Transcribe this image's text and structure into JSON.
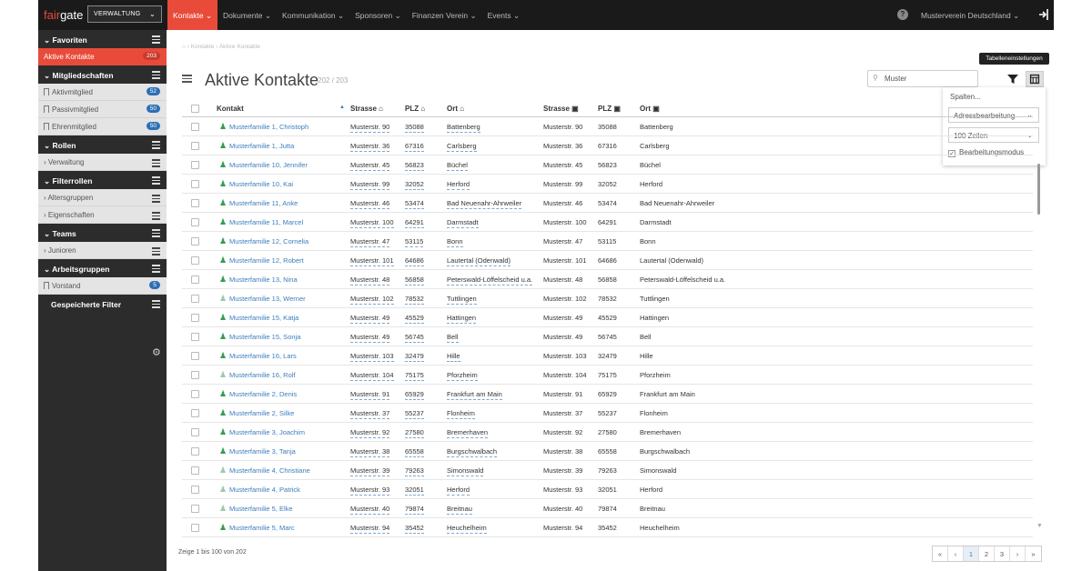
{
  "app": {
    "logo_part1": "fair",
    "logo_part2": "gate",
    "selector": "VERWALTUNG",
    "org_name": "Musterverein Deutschland"
  },
  "nav": [
    "Kontakte",
    "Dokumente",
    "Kommunikation",
    "Sponsoren",
    "Finanzen Verein",
    "Events"
  ],
  "sidebar": {
    "favoriten": {
      "title": "Favoriten",
      "items": [
        {
          "label": "Aktive Kontakte",
          "count": "203"
        }
      ]
    },
    "mitglied": {
      "title": "Mitgliedschaften",
      "items": [
        {
          "label": "Aktivmitglied",
          "count": "52"
        },
        {
          "label": "Passivmitglied",
          "count": "50"
        },
        {
          "label": "Ehrenmitglied",
          "count": "50"
        }
      ]
    },
    "rollen": {
      "title": "Rollen",
      "items": [
        {
          "label": "Verwaltung"
        }
      ]
    },
    "filter": {
      "title": "Filterrollen",
      "items": [
        {
          "label": "Altersgruppen"
        },
        {
          "label": "Eigenschaften"
        }
      ]
    },
    "teams": {
      "title": "Teams",
      "items": [
        {
          "label": "Junioren"
        }
      ]
    },
    "arbeit": {
      "title": "Arbeitsgruppen",
      "items": [
        {
          "label": "Vorstand",
          "count": "5"
        }
      ]
    },
    "saved": {
      "title": "Gespeicherte Filter"
    }
  },
  "breadcrumb": {
    "a": "Kontakte",
    "b": "Aktive Kontakte"
  },
  "page": {
    "title": "Aktive Kontakte",
    "count": "202 / 203"
  },
  "search": {
    "value": "Muster"
  },
  "tooltip": "Tabelleneinstellungen",
  "popup": {
    "label": "Spalten...",
    "select1": "Adressbearbeitung",
    "select2": "100 Zeilen",
    "checkbox": "Bearbeitungsmodus"
  },
  "columns": [
    "Kontakt",
    "Strasse",
    "PLZ",
    "Ort",
    "Strasse",
    "PLZ",
    "Ort"
  ],
  "rows": [
    [
      "Musterfamilie 1, Christoph",
      "Musterstr. 90",
      "35088",
      "Battenberg",
      "Musterstr. 90",
      "35088",
      "Battenberg"
    ],
    [
      "Musterfamilie 1, Jutta",
      "Musterstr. 36",
      "67316",
      "Carlsberg",
      "Musterstr. 36",
      "67316",
      "Carlsberg"
    ],
    [
      "Musterfamilie 10, Jennifer",
      "Musterstr. 45",
      "56823",
      "Büchel",
      "Musterstr. 45",
      "56823",
      "Büchel"
    ],
    [
      "Musterfamilie 10, Kai",
      "Musterstr. 99",
      "32052",
      "Herford",
      "Musterstr. 99",
      "32052",
      "Herford"
    ],
    [
      "Musterfamilie 11, Anke",
      "Musterstr. 46",
      "53474",
      "Bad Neuenahr-Ahrweiler",
      "Musterstr. 46",
      "53474",
      "Bad Neuenahr-Ahrweiler"
    ],
    [
      "Musterfamilie 11, Marcel",
      "Musterstr. 100",
      "64291",
      "Darmstadt",
      "Musterstr. 100",
      "64291",
      "Darmstadt"
    ],
    [
      "Musterfamilie 12, Cornelia",
      "Musterstr. 47",
      "53115",
      "Bonn",
      "Musterstr. 47",
      "53115",
      "Bonn"
    ],
    [
      "Musterfamilie 12, Robert",
      "Musterstr. 101",
      "64686",
      "Lautertal (Odenwald)",
      "Musterstr. 101",
      "64686",
      "Lautertal (Odenwald)"
    ],
    [
      "Musterfamilie 13, Nina",
      "Musterstr. 48",
      "56858",
      "Peterswald-Löffelscheid u.a.",
      "Musterstr. 48",
      "56858",
      "Peterswald-Löffelscheid u.a."
    ],
    [
      "Musterfamilie 13, Werner",
      "Musterstr. 102",
      "78532",
      "Tuttlingen",
      "Musterstr. 102",
      "78532",
      "Tuttlingen"
    ],
    [
      "Musterfamilie 15, Katja",
      "Musterstr. 49",
      "45529",
      "Hattingen",
      "Musterstr. 49",
      "45529",
      "Hattingen"
    ],
    [
      "Musterfamilie 15, Sonja",
      "Musterstr. 49",
      "56745",
      "Bell",
      "Musterstr. 49",
      "56745",
      "Bell"
    ],
    [
      "Musterfamilie 16, Lars",
      "Musterstr. 103",
      "32479",
      "Hille",
      "Musterstr. 103",
      "32479",
      "Hille"
    ],
    [
      "Musterfamilie 16, Rolf",
      "Musterstr. 104",
      "75175",
      "Pforzheim",
      "Musterstr. 104",
      "75175",
      "Pforzheim"
    ],
    [
      "Musterfamilie 2, Denis",
      "Musterstr. 91",
      "65929",
      "Frankfurt am Main",
      "Musterstr. 91",
      "65929",
      "Frankfurt am Main"
    ],
    [
      "Musterfamilie 2, Silke",
      "Musterstr. 37",
      "55237",
      "Flonheim",
      "Musterstr. 37",
      "55237",
      "Flonheim"
    ],
    [
      "Musterfamilie 3, Joachim",
      "Musterstr. 92",
      "27580",
      "Bremerhaven",
      "Musterstr. 92",
      "27580",
      "Bremerhaven"
    ],
    [
      "Musterfamilie 3, Tanja",
      "Musterstr. 38",
      "65558",
      "Burgschwalbach",
      "Musterstr. 38",
      "65558",
      "Burgschwalbach"
    ],
    [
      "Musterfamilie 4, Christiane",
      "Musterstr. 39",
      "79263",
      "Simonswald",
      "Musterstr. 39",
      "79263",
      "Simonswald"
    ],
    [
      "Musterfamilie 4, Patrick",
      "Musterstr. 93",
      "32051",
      "Herford",
      "Musterstr. 93",
      "32051",
      "Herford"
    ],
    [
      "Musterfamilie 5, Elke",
      "Musterstr. 40",
      "79874",
      "Breitnau",
      "Musterstr. 40",
      "79874",
      "Breitnau"
    ],
    [
      "Musterfamilie 5, Marc",
      "Musterstr. 94",
      "35452",
      "Heuchelheim",
      "Musterstr. 94",
      "35452",
      "Heuchelheim"
    ]
  ],
  "footer": "Zeige 1 bis 100 von 202",
  "pager": [
    "«",
    "‹",
    "1",
    "2",
    "3",
    "›",
    "»"
  ]
}
